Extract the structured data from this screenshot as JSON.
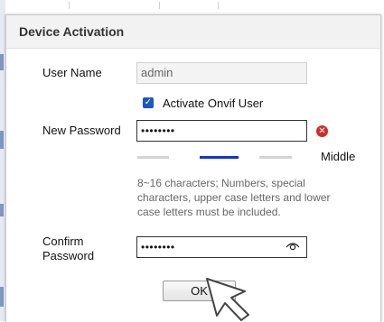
{
  "dialog": {
    "title": "Device Activation"
  },
  "form": {
    "user_name_label": "User Name",
    "user_name_value": "admin",
    "onvif_label": "Activate Onvif User",
    "onvif_checked": true,
    "new_password_label": "New Password",
    "new_password_value": "••••••••",
    "strength_label": "Middle",
    "strength_level": 2,
    "strength_levels_total": 3,
    "hint": "8~16 characters; Numbers, special characters, upper case letters and lower case letters must be included.",
    "confirm_password_label_line1": "Confirm",
    "confirm_password_label_line2": "Password",
    "confirm_password_value": "••••••••",
    "ok_label": "OK"
  },
  "icons": {
    "checkbox": "checkbox-checked-icon",
    "error": "error-clear-icon",
    "eye": "eye-icon",
    "cursor": "mouse-pointer-icon"
  },
  "colors": {
    "accent": "#1a56c7",
    "error": "#d42a2a",
    "strength_active": "#1133dd",
    "strength_inactive": "#d3d3d3"
  }
}
